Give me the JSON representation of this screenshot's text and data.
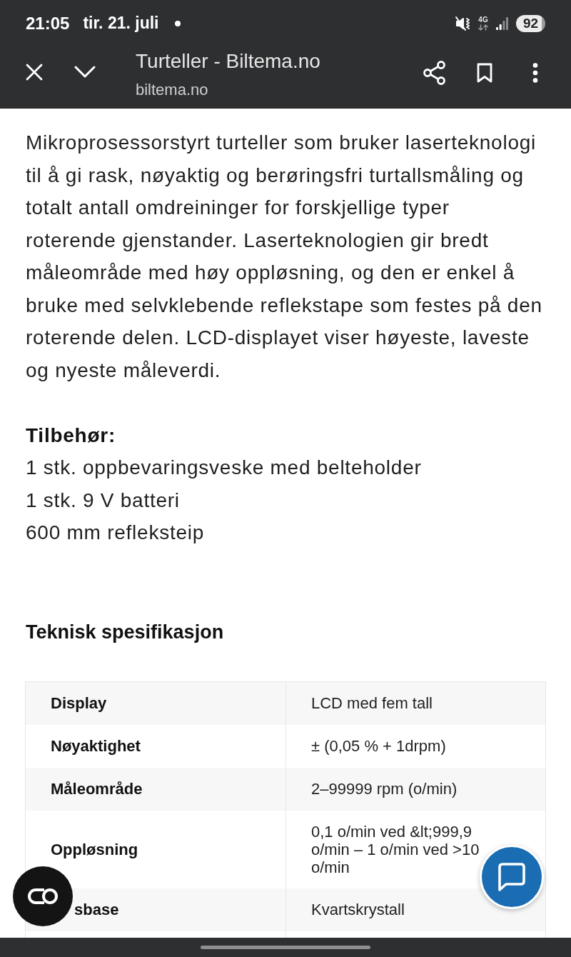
{
  "status_bar": {
    "time": "21:05",
    "date": "tir. 21. juli",
    "network": "4G",
    "battery": "92"
  },
  "toolbar": {
    "title": "Turteller - Biltema.no",
    "url": "biltema.no"
  },
  "description": "Mikroprosessorstyrt turteller som bruker laserteknologi til å gi rask, nøyaktig og berøringsfri turtallsmåling og totalt antall omdreininger for forskjellige typer roterende gjenstander. Laserteknologien gir bredt måleområde med høy oppløsning, og den er enkel å bruke med selvklebende reflekstape som festes på den roterende delen. LCD-displayet viser høyeste, laveste og nyeste måleverdi.",
  "accessories": {
    "heading": "Tilbehør:",
    "items": [
      "1 stk. oppbevaringsveske med belteholder",
      "1 stk. 9 V batteri",
      "600 mm refleksteip"
    ]
  },
  "specs": {
    "heading": "Teknisk spesifikasjon",
    "rows": [
      {
        "label": "Display",
        "value": "LCD med fem tall"
      },
      {
        "label": "Nøyaktighet",
        "value": "± (0,05 % + 1drpm)"
      },
      {
        "label": "Måleområde",
        "value": "2–99999 rpm (o/min)"
      },
      {
        "label": "Oppløsning",
        "value": "0,1 o/min ved &lt;999,9 o/min – 1 o/min ved >10 o/min"
      },
      {
        "label": "sbase",
        "value": "Kvartskrystall"
      }
    ]
  }
}
